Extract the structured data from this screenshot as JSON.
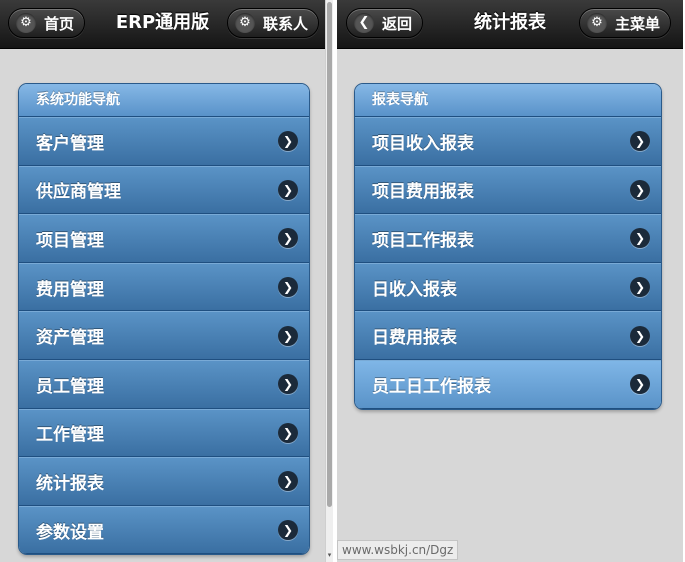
{
  "left_screen": {
    "header": {
      "home_button": {
        "label": "首页",
        "icon": "gear-icon"
      },
      "title": "ERP通用版",
      "contacts_button": {
        "label": "联系人",
        "icon": "gear-icon"
      }
    },
    "nav": {
      "divider": "系统功能导航",
      "items": [
        {
          "label": "客户管理"
        },
        {
          "label": "供应商管理"
        },
        {
          "label": "项目管理"
        },
        {
          "label": "费用管理"
        },
        {
          "label": "资产管理"
        },
        {
          "label": "员工管理"
        },
        {
          "label": "工作管理"
        },
        {
          "label": "统计报表"
        },
        {
          "label": "参数设置"
        }
      ]
    }
  },
  "right_screen": {
    "header": {
      "back_button": {
        "label": "返回",
        "icon": "chevron-left-icon"
      },
      "title": "统计报表",
      "menu_button": {
        "label": "主菜单",
        "icon": "gear-icon"
      }
    },
    "nav": {
      "divider": "报表导航",
      "items": [
        {
          "label": "项目收入报表"
        },
        {
          "label": "项目费用报表"
        },
        {
          "label": "项目工作报表"
        },
        {
          "label": "日收入报表"
        },
        {
          "label": "日费用报表"
        },
        {
          "label": "员工日工作报表",
          "active": true
        }
      ]
    }
  },
  "watermark": "www.wsbkj.cn/Dgz",
  "colors": {
    "header_bg": "#1f1f1f",
    "list_item": "#3f74a7",
    "list_item_active": "#6aa3d6",
    "page_bg": "#d7d7d7"
  }
}
